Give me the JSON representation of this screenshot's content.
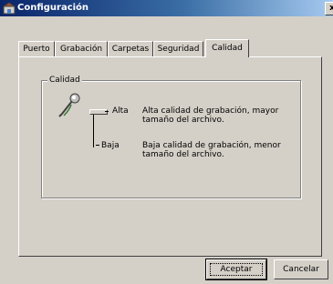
{
  "window": {
    "title": "Configuración",
    "close_glyph": "x"
  },
  "tabs": [
    {
      "label": "Puerto",
      "active": false
    },
    {
      "label": "Grabación",
      "active": false
    },
    {
      "label": "Carpetas",
      "active": false
    },
    {
      "label": "Seguridad",
      "active": false
    },
    {
      "label": "Calidad",
      "active": true
    }
  ],
  "quality": {
    "group_label": "Calidad",
    "high_label": "Alta",
    "high_desc": "Alta calidad de grabación, mayor tamaño del archivo.",
    "low_label": "Baja",
    "low_desc": "Baja calidad de grabación, menor tamaño del archivo.",
    "slider_value": "Alta"
  },
  "buttons": {
    "ok_label": "Aceptar",
    "cancel_label": "Cancelar"
  },
  "icons": {
    "app": "settings-app-icon",
    "mic": "microphone-icon"
  }
}
